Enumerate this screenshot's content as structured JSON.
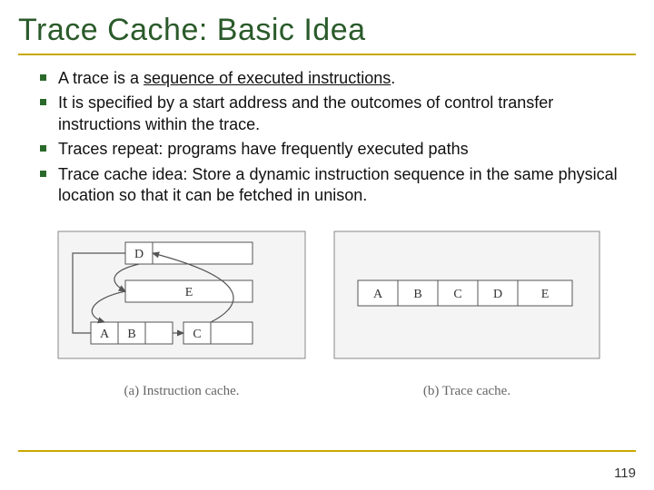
{
  "title": "Trace Cache: Basic Idea",
  "bullets": {
    "b1_pre": "A trace is a ",
    "b1_u": "sequence of executed instructions",
    "b1_post": ".",
    "b2": "It is specified by a start address and the outcomes of control transfer instructions within the trace.",
    "b3": "Traces repeat: programs have frequently executed paths",
    "b4": "Trace cache idea: Store a dynamic instruction sequence in the same physical location so that it can be fetched in unison."
  },
  "figure": {
    "blocks": {
      "A": "A",
      "B": "B",
      "C": "C",
      "D": "D",
      "E": "E"
    },
    "caption_a": "(a) Instruction cache.",
    "caption_b": "(b) Trace cache."
  },
  "page_number": "119"
}
